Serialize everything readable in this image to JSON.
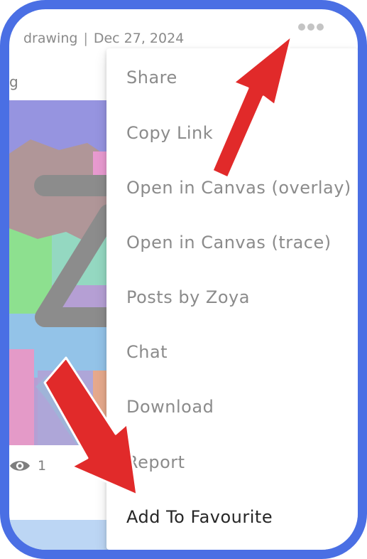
{
  "post_meta": {
    "category": "drawing",
    "separator": "|",
    "date": "Dec 27, 2024"
  },
  "caption_fragment": "g",
  "views": {
    "icon": "eye-icon",
    "count": "1"
  },
  "more_menu_icon": "more-horizontal-icon",
  "menu": {
    "items": [
      {
        "label": "Share"
      },
      {
        "label": "Copy Link"
      },
      {
        "label": "Open in Canvas (overlay)"
      },
      {
        "label": "Open in Canvas (trace)"
      },
      {
        "label": "Posts by Zoya"
      },
      {
        "label": "Chat"
      },
      {
        "label": "Download"
      },
      {
        "label": "Report"
      },
      {
        "label": "Add To Favourite"
      }
    ]
  },
  "annotations": {
    "arrow_color": "#e12a2a",
    "frame_color": "#4a6fe4"
  }
}
